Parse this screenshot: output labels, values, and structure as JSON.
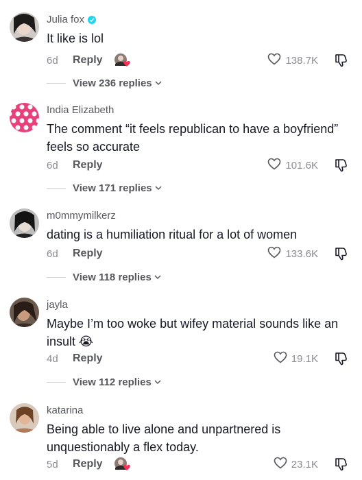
{
  "comments": [
    {
      "author": "Julia fox",
      "verified": true,
      "text": "It like is lol",
      "age": "6d",
      "reply_label": "Reply",
      "creator_liked": true,
      "likes": "138.7K",
      "view_replies": "View 236 replies"
    },
    {
      "author": "India Elizabeth",
      "verified": false,
      "text": "The comment “it feels republican to have a boyfriend” feels so accurate",
      "age": "6d",
      "reply_label": "Reply",
      "creator_liked": false,
      "likes": "101.6K",
      "view_replies": "View 171 replies"
    },
    {
      "author": "m0mmymilkerz",
      "verified": false,
      "text": "dating is a humiliation ritual for a lot of women",
      "age": "6d",
      "reply_label": "Reply",
      "creator_liked": false,
      "likes": "133.6K",
      "view_replies": "View 118 replies"
    },
    {
      "author": "jayla",
      "verified": false,
      "text": "Maybe I’m too woke but wifey material sounds like an insult",
      "emoji": "😭",
      "age": "4d",
      "reply_label": "Reply",
      "creator_liked": false,
      "likes": "19.1K",
      "view_replies": "View 112 replies"
    },
    {
      "author": "katarina",
      "verified": false,
      "text": "Being able to live alone and unpartnered is unquestionably a flex today.",
      "age": "5d",
      "reply_label": "Reply",
      "creator_liked": true,
      "likes": "23.1K"
    }
  ],
  "colors": {
    "primary_text": "#161823",
    "secondary_text": "#57585e",
    "muted_text": "#8a8b91",
    "verified_badge": "#20d5ec",
    "heart_red": "#fe2c55"
  }
}
